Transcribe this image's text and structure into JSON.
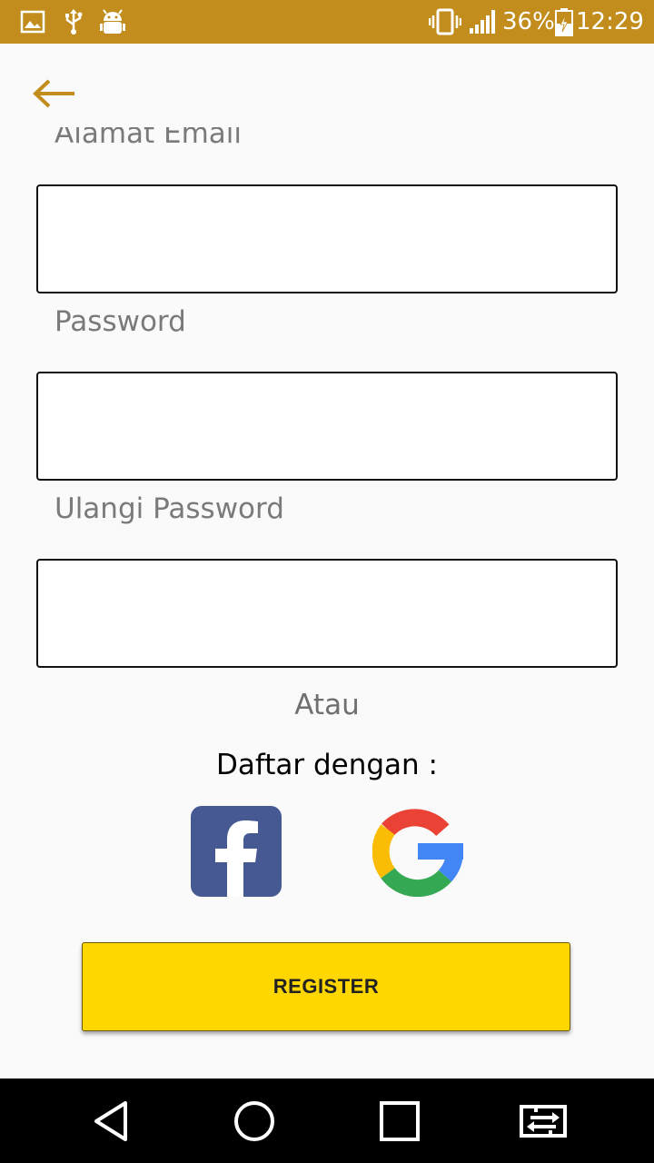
{
  "status_bar": {
    "battery": "36%",
    "time": "12:29",
    "left_icons": [
      "image-icon",
      "usb-icon",
      "android-debug-icon"
    ],
    "right_icons": [
      "vibrate-icon",
      "signal-icon",
      "battery-charging-icon"
    ]
  },
  "header": {
    "back_icon": "arrow-left-icon",
    "accent_color": "#c28d1d"
  },
  "form": {
    "email_label": "Alamat Email",
    "email_value": "",
    "password_label": "Password",
    "password_value": "",
    "repeat_password_label": "Ulangi Password",
    "repeat_password_value": ""
  },
  "divider_text": "Atau",
  "social": {
    "label": "Daftar dengan :",
    "providers": [
      "facebook-icon",
      "google-icon"
    ]
  },
  "register_button": {
    "label": "REGISTER",
    "color": "#fed700"
  },
  "nav_bar": {
    "buttons": [
      "back-icon",
      "home-icon",
      "recents-icon",
      "switch-app-icon"
    ]
  }
}
